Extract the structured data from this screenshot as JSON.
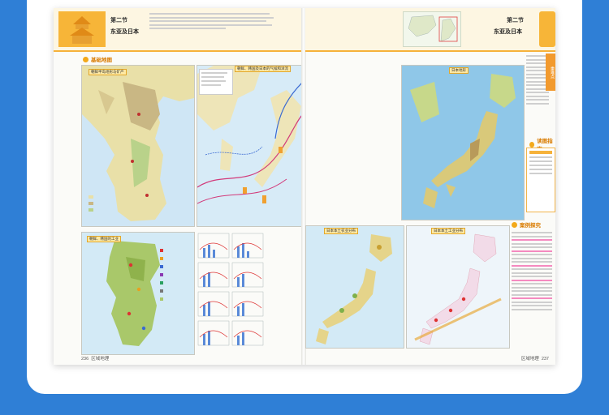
{
  "left_page": {
    "section_number": "第二节",
    "section_title": "东亚及日本",
    "basic_maps_heading": "基础地图",
    "map_korea_terrain": "朝鲜半岛地形与矿产",
    "map_climate": "朝鲜、韩国及日本的气候和洋流",
    "map_industry": "朝鲜、韩国的工业",
    "page_number": "236",
    "folio_name": "区域地理"
  },
  "right_page": {
    "section_number": "第二节",
    "section_title": "东亚及日本",
    "map_japan_terrain": "日本地形",
    "side_tab": "重难点",
    "reading_guide_heading": "读图指南",
    "case_study_heading": "案例探究",
    "map_agriculture": "日本本土农业分布",
    "map_japan_industry": "日本本土工业分布",
    "page_number": "237",
    "folio_name": "区域地理"
  },
  "colors": {
    "background": "#2f7fd6",
    "accent": "#f6b23a",
    "sea": "#cfe6f5",
    "land": "#e9e0a8"
  }
}
